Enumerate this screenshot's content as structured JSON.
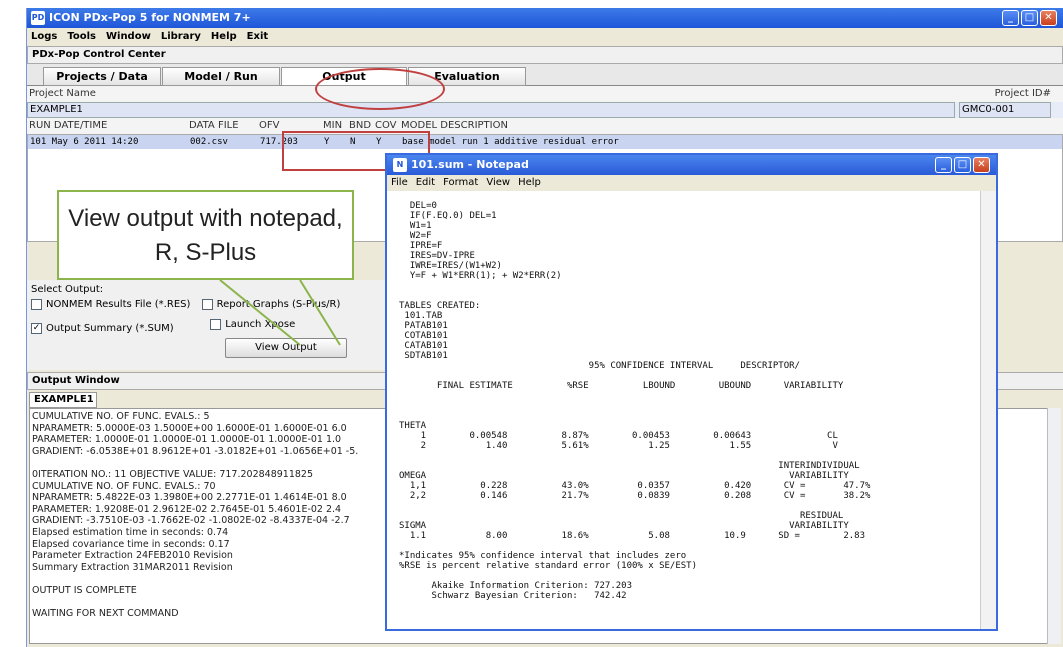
{
  "app": {
    "title": "ICON PDx-Pop 5 for NONMEM 7+"
  },
  "menu": [
    "Logs",
    "Tools",
    "Window",
    "Library",
    "Help",
    "Exit"
  ],
  "control_center": {
    "title": "PDx-Pop Control Center"
  },
  "tabs": [
    "Projects / Data",
    "Model / Run",
    "Output",
    "Evaluation"
  ],
  "project": {
    "name_label": "Project Name",
    "name": "EXAMPLE1",
    "id_label": "Project ID#",
    "id": "GMC0-001"
  },
  "run_table": {
    "headers": [
      "RUN DATE/TIME",
      "DATA FILE",
      "OFV",
      "MIN",
      "BND",
      "COV",
      "MODEL DESCRIPTION"
    ],
    "row": [
      "101 May 6 2011 14:20",
      "002.csv",
      "717.203",
      "Y",
      "N",
      "Y",
      "base model run 1 additive residual error"
    ]
  },
  "select_output": {
    "label": "Select Output:",
    "nonmem_results": "NONMEM Results File (*.RES)",
    "report_graphs": "Report Graphs (S-Plus/R)",
    "output_summary": "Output Summary (*.SUM)",
    "launch_xpose": "Launch Xpose",
    "view_button": "View Output"
  },
  "output_window": {
    "title": "Output Window",
    "tab": "EXAMPLE1",
    "lines": [
      "CUMULATIVE NO. OF FUNC. EVALS.:    5",
      "NPARAMETR:  5.0000E-03  1.5000E+00  1.6000E-01  1.6000E-01  6.0",
      "PARAMETER:  1.0000E-01  1.0000E-01  1.0000E-01  1.0000E-01  1.0",
      "GRADIENT:  -6.0538E+01  8.9612E+01 -3.0182E+01 -1.0656E+01 -5.",
      "",
      "0ITERATION NO.:   11    OBJECTIVE VALUE:  717.202848911825",
      "CUMULATIVE NO. OF FUNC. EVALS.:   70",
      "NPARAMETR:  5.4822E-03  1.3980E+00  2.2771E-01  1.4614E-01  8.0",
      "PARAMETER:  1.9208E-01  2.9612E-02  2.7645E-01  5.4601E-02  2.4",
      "GRADIENT:  -3.7510E-03 -1.7662E-02 -1.0802E-02 -8.4337E-04 -2.7",
      "Elapsed estimation time in seconds:     0.74",
      "Elapsed covariance time in seconds:     0.17",
      "Parameter Extraction 24FEB2010 Revision",
      "Summary Extraction 31MAR2011 Revision",
      "",
      "OUTPUT IS COMPLETE",
      "",
      "WAITING FOR NEXT COMMAND"
    ]
  },
  "notepad": {
    "title": "101.sum - Notepad",
    "menu": [
      "File",
      "Edit",
      "Format",
      "View",
      "Help"
    ],
    "text": "  DEL=0\n  IF(F.EQ.0) DEL=1\n  W1=1\n  W2=F\n  IPRE=F\n  IRES=DV-IPRE\n  IWRE=IRES/(W1+W2)\n  Y=F + W1*ERR(1); + W2*ERR(2)\n\n\nTABLES CREATED:\n 101.TAB\n PATAB101\n COTAB101\n CATAB101\n SDTAB101\n                                   95% CONFIDENCE INTERVAL     DESCRIPTOR/\n\n       FINAL ESTIMATE          %RSE          LBOUND        UBOUND      VARIABILITY\n\n\n\nTHETA\n    1        0.00548          8.87%        0.00453        0.00643              CL\n    2           1.40          5.61%           1.25           1.55               V\n\n                                                                      INTERINDIVIDUAL\nOMEGA                                                                   VARIABILITY\n  1,1          0.228          43.0%         0.0357          0.420      CV =       47.7%\n  2,2          0.146          21.7%         0.0839          0.208      CV =       38.2%\n\n                                                                          RESIDUAL\nSIGMA                                                                   VARIABILITY\n  1.1           8.00          18.6%           5.08          10.9      SD =        2.83\n\n*Indicates 95% confidence interval that includes zero\n%RSE is percent relative standard error (100% x SE/EST)\n\n      Akaike Information Criterion: 727.203\n      Schwarz Bayesian Criterion:   742.42"
  },
  "annotation": {
    "callout": "View output with notepad, R, S-Plus"
  }
}
